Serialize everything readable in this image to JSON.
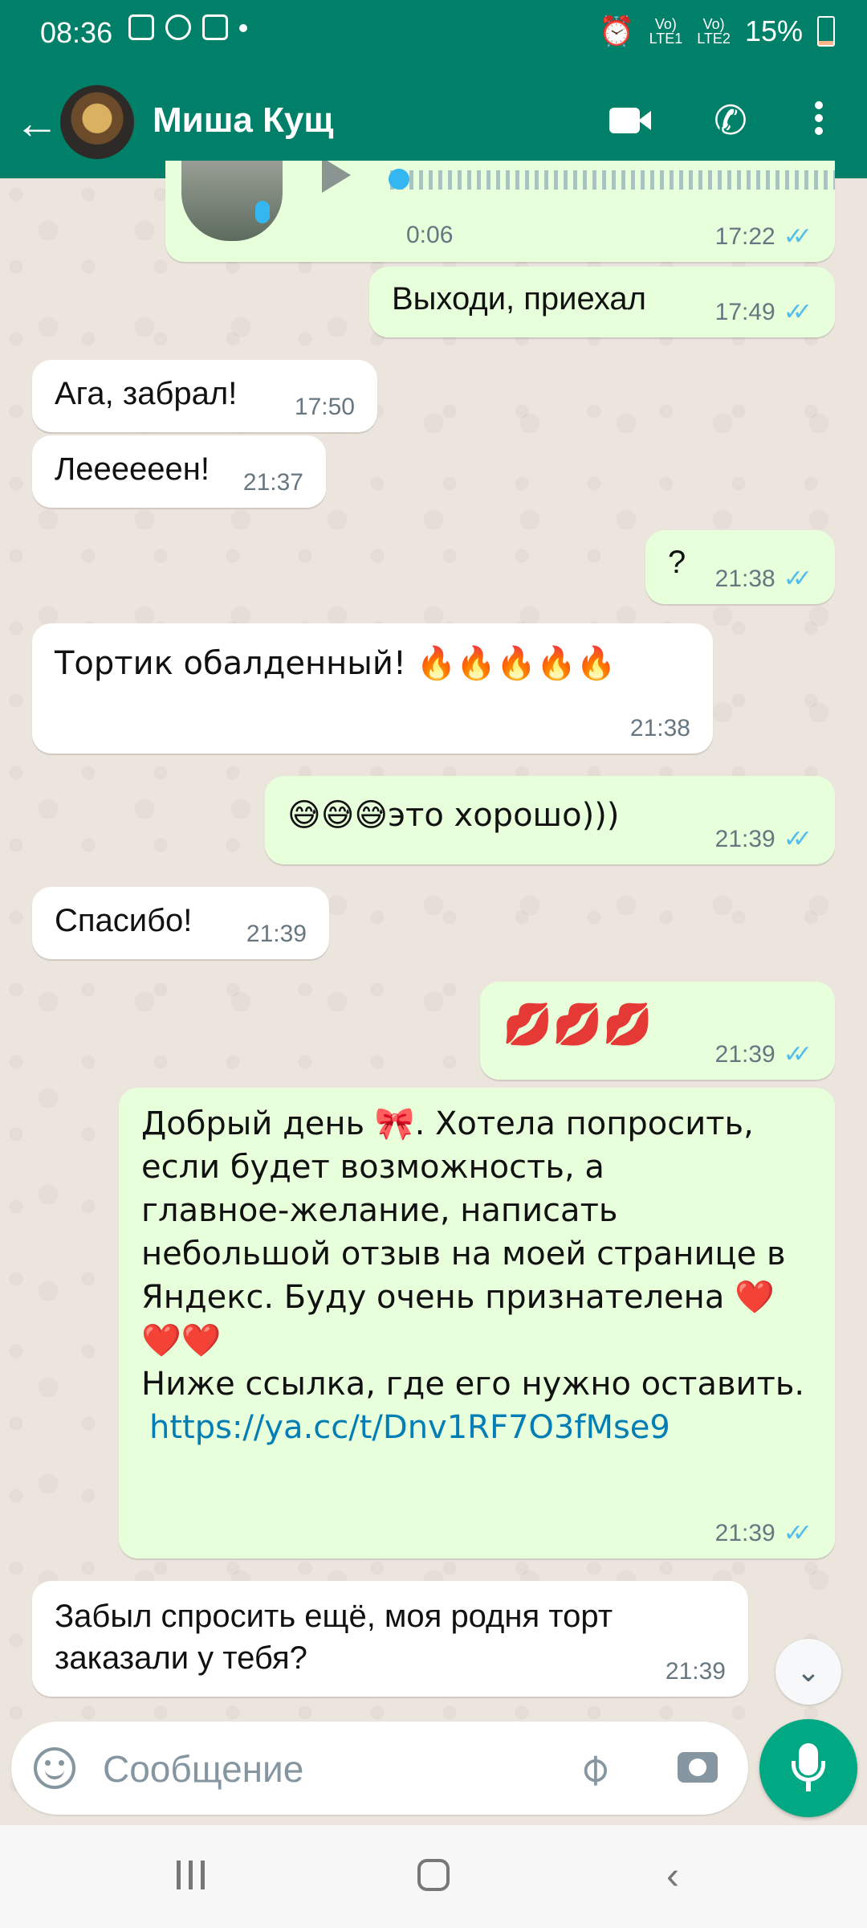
{
  "status_bar": {
    "time": "08:36",
    "sim1": "LTE1",
    "sim2": "LTE2",
    "volte1": "Vo)",
    "volte2": "Vo)",
    "battery": "15%"
  },
  "header": {
    "contact_name": "Миша Кущ",
    "back_icon": "arrow-left-icon",
    "video_icon": "video-camera-icon",
    "call_icon": "phone-icon",
    "menu_icon": "more-vert-icon"
  },
  "messages": {
    "voice": {
      "duration": "0:06",
      "time": "17:22"
    },
    "m1": {
      "text": "Выходи, приехал",
      "time": "17:49"
    },
    "m2": {
      "text": "Ага, забрал!",
      "time": "17:50"
    },
    "m3": {
      "text": "Леееееен!",
      "time": "21:37"
    },
    "m4": {
      "text": "?",
      "time": "21:38"
    },
    "m5": {
      "text": "Тортик обалденный! 🔥🔥🔥🔥🔥",
      "time": "21:38"
    },
    "m6": {
      "text": "😅😅😅это хорошо)))",
      "time": "21:39"
    },
    "m7": {
      "text": "Спасибо!",
      "time": "21:39"
    },
    "m8": {
      "text": "💋💋💋",
      "time": "21:39"
    },
    "m9": {
      "line1": "Добрый день 🎀.  Хотела попросить,",
      "line2": "если будет возможность,  а",
      "line3": "главное-желание,  написать",
      "line4": "небольшой отзыв на моей странице в",
      "line5": "Яндекс.  Буду очень признателена ❤️",
      "line6": "❤️❤️",
      "line7": "Ниже ссылка, где его нужно оставить.",
      "link": "https://ya.cc/t/Dnv1RF7O3fMse9",
      "time": "21:39"
    },
    "m10": {
      "line1": "Забыл спросить ещё, моя родня торт",
      "line2": "заказали у тебя?",
      "time": "21:39"
    },
    "ticks": "✓✓"
  },
  "composer": {
    "placeholder": "Сообщение",
    "emoji_icon": "smiley-icon",
    "attach_icon": "paperclip-icon",
    "camera_icon": "camera-icon",
    "mic_icon": "microphone-icon"
  },
  "colors": {
    "header": "#008069",
    "outgoing_bubble": "#e7ffdb",
    "incoming_bubble": "#ffffff",
    "read_ticks": "#53bdeb",
    "mic_button": "#00a884"
  }
}
